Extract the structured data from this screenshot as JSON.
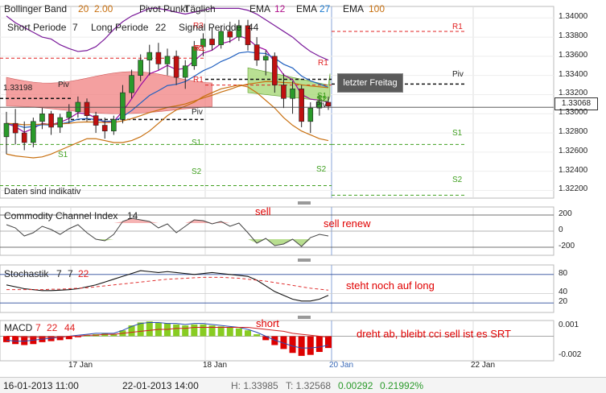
{
  "header": {
    "line1": [
      {
        "text": "Bollinger Band",
        "color": "#222"
      },
      {
        "text": "20",
        "color": "#c87010"
      },
      {
        "text": "2.00",
        "color": "#c87010"
      },
      {
        "text": "Pivot Punkt",
        "color": "#222"
      },
      {
        "text": "Täglich",
        "color": "#222"
      },
      {
        "text": "EMA",
        "color": "#222"
      },
      {
        "text": "12",
        "color": "#b0108a"
      },
      {
        "text": "EMA",
        "color": "#222"
      },
      {
        "text": "27",
        "color": "#1a7ad0"
      },
      {
        "text": "EMA",
        "color": "#222"
      },
      {
        "text": "100",
        "color": "#c87010"
      }
    ],
    "line2": [
      {
        "text": "Short Periode",
        "color": "#222"
      },
      {
        "text": "7",
        "color": "#222"
      },
      {
        "text": "Long Periode",
        "color": "#222"
      },
      {
        "text": "22",
        "color": "#222"
      },
      {
        "text": "Signal Periode",
        "color": "#222"
      },
      {
        "text": "44",
        "color": "#222"
      }
    ]
  },
  "notice": "Daten sind indikativ",
  "current_price": "1.33068",
  "callout": "letzter Freitag",
  "status": {
    "start": "16-01-2013 11:00",
    "end": "22-01-2013 14:00",
    "high": "H: 1.33985",
    "low": "T: 1.32568",
    "change": "0.00292",
    "change_pct": "0.21992%"
  },
  "colors": {
    "up": "#2a9a2a",
    "down": "#c01010",
    "ichimoku_red": "#f08080",
    "ichimoku_green": "#a8d878",
    "ema12": "#9a0aa0",
    "ema27": "#2060c0",
    "ema100": "#c87010",
    "stoch_main": "#111111",
    "stoch_signal": "#e03030",
    "macd_pos": "#88cc22",
    "macd_neg": "#dd0000"
  },
  "chart_data": [
    {
      "type": "candlestick",
      "panel": "price",
      "y_ticks": [
        "1.34000",
        "1.33800",
        "1.33600",
        "1.33400",
        "1.33200",
        "1.33000",
        "1.32800",
        "1.32600",
        "1.32400",
        "1.32200"
      ],
      "ylim": [
        1.3212,
        1.3412
      ],
      "x_ticks": [
        "17 Jan",
        "18 Jan",
        "20 Jan",
        "22 Jan"
      ],
      "current_price": 1.33068,
      "side_label": "1.33198",
      "pivot_labels": [
        {
          "text": "R1",
          "color": "#e02020"
        },
        {
          "text": "Piv",
          "color": "#222"
        },
        {
          "text": "S1",
          "color": "#40a020"
        },
        {
          "text": "S2",
          "color": "#40a020"
        },
        {
          "text": "R1",
          "color": "#e02020"
        },
        {
          "text": "Piv",
          "color": "#222"
        },
        {
          "text": "S1",
          "color": "#40a020"
        },
        {
          "text": "S2",
          "color": "#40a020"
        },
        {
          "text": "R1",
          "color": "#e02020"
        },
        {
          "text": "Piv",
          "color": "#222"
        },
        {
          "text": "S1",
          "color": "#40a020"
        },
        {
          "text": "S2",
          "color": "#40a020"
        },
        {
          "text": "R1",
          "color": "#e02020"
        },
        {
          "text": "Piv",
          "color": "#222"
        },
        {
          "text": "S1",
          "color": "#40a020"
        },
        {
          "text": "S2",
          "color": "#40a020"
        },
        {
          "text": "S1",
          "color": "#40a020"
        },
        {
          "text": "R3",
          "color": "#e02020"
        },
        {
          "text": "R2",
          "color": "#e02020"
        }
      ],
      "pivots": [
        {
          "R1": 1.3358,
          "Piv": 1.3316,
          "S1": 1.3268,
          "S2": 1.3225
        },
        {
          "R1": 1.3358,
          "Piv": 1.3294,
          "S1": 1.3268,
          "S2": 1.3225
        },
        {
          "R1": 1.333,
          "Piv": 1.3336,
          "S1": 1.3268,
          "S2": 1.3225
        },
        {
          "R1": 1.3386,
          "Piv": 1.3331,
          "S1": 1.3268,
          "S2": 1.3215
        }
      ],
      "candles": [
        [
          1.3276,
          1.3302,
          1.3258,
          1.329
        ],
        [
          1.329,
          1.3305,
          1.3268,
          1.328
        ],
        [
          1.328,
          1.3292,
          1.3262,
          1.327
        ],
        [
          1.327,
          1.3296,
          1.3265,
          1.3292
        ],
        [
          1.3292,
          1.3306,
          1.3284,
          1.33
        ],
        [
          1.33,
          1.3303,
          1.3278,
          1.3286
        ],
        [
          1.3286,
          1.33,
          1.328,
          1.3296
        ],
        [
          1.3296,
          1.331,
          1.329,
          1.3302
        ],
        [
          1.3302,
          1.3318,
          1.3296,
          1.3312
        ],
        [
          1.3312,
          1.3316,
          1.3292,
          1.3298
        ],
        [
          1.3298,
          1.3302,
          1.328,
          1.3288
        ],
        [
          1.3288,
          1.3296,
          1.3274,
          1.3282
        ],
        [
          1.3282,
          1.3298,
          1.3278,
          1.3294
        ],
        [
          1.3294,
          1.333,
          1.329,
          1.3322
        ],
        [
          1.3322,
          1.3346,
          1.3316,
          1.334
        ],
        [
          1.334,
          1.3362,
          1.3334,
          1.3356
        ],
        [
          1.3356,
          1.3372,
          1.334,
          1.3364
        ],
        [
          1.3364,
          1.3374,
          1.3346,
          1.3352
        ],
        [
          1.3352,
          1.3368,
          1.334,
          1.336
        ],
        [
          1.336,
          1.3366,
          1.333,
          1.3338
        ],
        [
          1.3338,
          1.3356,
          1.3326,
          1.335
        ],
        [
          1.335,
          1.3376,
          1.3346,
          1.337
        ],
        [
          1.337,
          1.3384,
          1.336,
          1.3378
        ],
        [
          1.3378,
          1.339,
          1.3366,
          1.3372
        ],
        [
          1.3372,
          1.3392,
          1.3368,
          1.3386
        ],
        [
          1.3386,
          1.3396,
          1.3374,
          1.338
        ],
        [
          1.338,
          1.3398,
          1.3376,
          1.3392
        ],
        [
          1.3392,
          1.3398,
          1.3366,
          1.3372
        ],
        [
          1.3372,
          1.338,
          1.335,
          1.3356
        ],
        [
          1.3356,
          1.3366,
          1.334,
          1.336
        ],
        [
          1.336,
          1.3364,
          1.3322,
          1.333
        ],
        [
          1.333,
          1.3342,
          1.3306,
          1.3316
        ],
        [
          1.3316,
          1.3334,
          1.33,
          1.3326
        ],
        [
          1.3326,
          1.333,
          1.3286,
          1.3292
        ],
        [
          1.3292,
          1.3312,
          1.328,
          1.3306
        ],
        [
          1.3306,
          1.332,
          1.3298,
          1.3312
        ],
        [
          1.3312,
          1.3318,
          1.3304,
          1.3308
        ]
      ],
      "bollinger_upper": [
        1.3402,
        1.3395,
        1.339,
        1.3385,
        1.338,
        1.3378,
        1.3372,
        1.3368,
        1.3365,
        1.3366,
        1.337,
        1.3378,
        1.3388,
        1.3396,
        1.3402,
        1.3406,
        1.341,
        1.341,
        1.3408,
        1.3406,
        1.3404,
        1.3406,
        1.3408,
        1.341,
        1.341,
        1.341,
        1.341,
        1.3408,
        1.3404,
        1.3398,
        1.3392,
        1.3386,
        1.338,
        1.3372,
        1.3365,
        1.336,
        1.3356
      ],
      "bollinger_lower": [
        1.3258,
        1.3256,
        1.3255,
        1.3254,
        1.3255,
        1.3258,
        1.3262,
        1.3266,
        1.327,
        1.3274,
        1.3274,
        1.3272,
        1.327,
        1.327,
        1.3272,
        1.3276,
        1.3282,
        1.329,
        1.3298,
        1.3304,
        1.3308,
        1.3312,
        1.3318,
        1.3322,
        1.3326,
        1.3328,
        1.333,
        1.3328,
        1.3322,
        1.3314,
        1.3306,
        1.3296,
        1.3288,
        1.3282,
        1.3278,
        1.3274,
        1.3272
      ]
    },
    {
      "type": "line",
      "panel": "cci",
      "title": "Commodity Channel Index",
      "param": "14",
      "y_ticks": [
        "200",
        "0",
        "-200"
      ],
      "ylim": [
        -300,
        300
      ],
      "annotations": [
        "sell",
        "sell renew"
      ],
      "values": [
        80,
        40,
        -60,
        -20,
        60,
        20,
        -40,
        30,
        80,
        -20,
        -100,
        -120,
        -40,
        120,
        160,
        140,
        120,
        40,
        90,
        -20,
        60,
        140,
        130,
        90,
        120,
        60,
        100,
        -20,
        -150,
        -90,
        -180,
        -160,
        -100,
        -190,
        -80,
        -40,
        -60
      ]
    },
    {
      "type": "line",
      "panel": "stochastic",
      "title": "Stochastik",
      "params": [
        "7",
        "7"
      ],
      "signal_param": "22",
      "y_ticks": [
        "80",
        "40",
        "20"
      ],
      "ylim": [
        0,
        100
      ],
      "annotations": [
        "steht noch auf long"
      ],
      "series": [
        {
          "values": [
            58,
            54,
            50,
            48,
            46,
            46,
            47,
            48,
            50,
            54,
            58,
            64,
            70,
            76,
            82,
            88,
            86,
            84,
            86,
            84,
            82,
            80,
            82,
            84,
            82,
            80,
            78,
            76,
            68,
            56,
            44,
            36,
            28,
            24,
            24,
            28,
            36
          ]
        },
        {
          "values": [
            48,
            48,
            48,
            48,
            48,
            49,
            49,
            50,
            51,
            52,
            54,
            56,
            58,
            60,
            62,
            64,
            66,
            68,
            70,
            71,
            72,
            73,
            74,
            74,
            74,
            73,
            72,
            70,
            68,
            66,
            63,
            60,
            57,
            54,
            51,
            49,
            47
          ]
        }
      ]
    },
    {
      "type": "bar",
      "panel": "macd",
      "title": "MACD",
      "params": [
        "7",
        "22",
        "44"
      ],
      "y_ticks": [
        "0.001",
        "-0.002"
      ],
      "ylim": [
        -0.0025,
        0.0016
      ],
      "annotations": [
        "short",
        "dreht ab, bleibt cci sell ist es SRT"
      ],
      "values": [
        -0.0006,
        -0.0008,
        -0.0009,
        -0.0008,
        -0.0006,
        -0.0005,
        -0.0004,
        -0.0003,
        -0.0001,
        0.0001,
        0.0002,
        0.0003,
        0.0002,
        0.0006,
        0.0011,
        0.0014,
        0.0015,
        0.0014,
        0.0013,
        0.0012,
        0.0011,
        0.0012,
        0.0012,
        0.0011,
        0.001,
        0.0009,
        0.0008,
        0.0006,
        0.0002,
        -0.0004,
        -0.0009,
        -0.0013,
        -0.0017,
        -0.002,
        -0.0019,
        -0.0016,
        -0.0012
      ],
      "macd_line": [
        -0.0004,
        -0.0005,
        -0.0005,
        -0.0004,
        -0.0003,
        -0.0002,
        -0.0001,
        0.0,
        0.0001,
        0.0002,
        0.0003,
        0.0003,
        0.0003,
        0.0006,
        0.001,
        0.0013,
        0.0014,
        0.0014,
        0.0013,
        0.0013,
        0.0012,
        0.0013,
        0.0013,
        0.0012,
        0.0011,
        0.001,
        0.0009,
        0.0007,
        0.0004,
        0.0,
        -0.0004,
        -0.0007,
        -0.001,
        -0.0012,
        -0.0012,
        -0.0011,
        -0.0009
      ],
      "signal_line": [
        0.0,
        0.0,
        -0.0001,
        -0.0001,
        -0.0001,
        -0.0001,
        -0.0001,
        0.0,
        0.0,
        0.0001,
        0.0001,
        0.0002,
        0.0002,
        0.0003,
        0.0004,
        0.0005,
        0.0006,
        0.0007,
        0.0007,
        0.0008,
        0.0008,
        0.0009,
        0.0009,
        0.0009,
        0.0009,
        0.0009,
        0.0009,
        0.0009,
        0.0008,
        0.0007,
        0.0006,
        0.0005,
        0.0003,
        0.0002,
        0.0001,
        0.0,
        -0.0001
      ]
    }
  ]
}
